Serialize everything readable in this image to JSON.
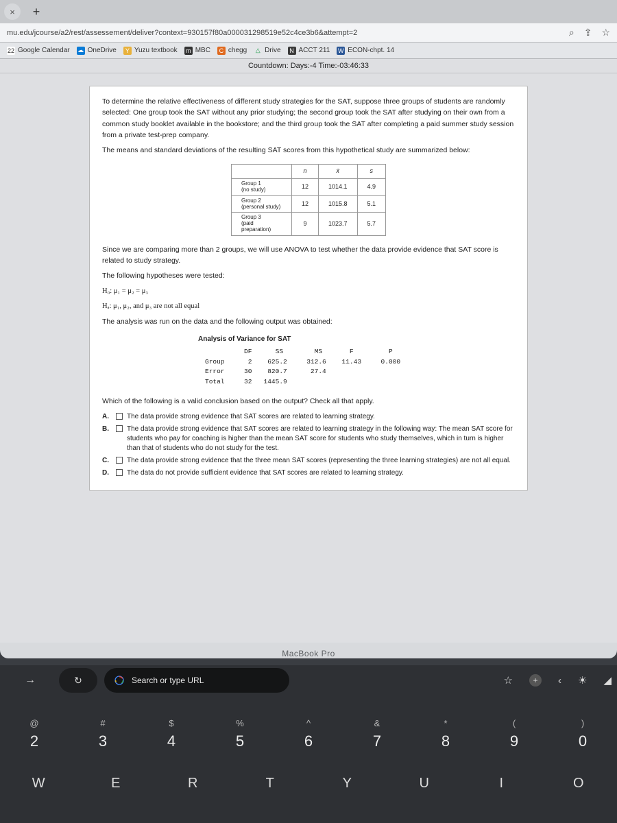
{
  "tabs": {
    "plus": "+",
    "close": "×"
  },
  "url": "mu.edu/jcourse/a2/rest/assessement/deliver?context=930157f80a000031298519e52c4ce3b6&attempt=2",
  "bookmarks": [
    {
      "icon": "22",
      "iconBg": "#fff",
      "iconColor": "#333",
      "label": "Google Calendar"
    },
    {
      "icon": "☁",
      "iconBg": "#0a7bd6",
      "iconColor": "#fff",
      "label": "OneDrive"
    },
    {
      "icon": "Y",
      "iconBg": "#e8b13b",
      "iconColor": "#fff",
      "label": "Yuzu textbook"
    },
    {
      "icon": "m",
      "iconBg": "#333",
      "iconColor": "#fff",
      "label": "MBC"
    },
    {
      "icon": "C",
      "iconBg": "#e06a1f",
      "iconColor": "#fff",
      "label": "chegg"
    },
    {
      "icon": "△",
      "iconBg": "transparent",
      "iconColor": "#1f9d4a",
      "label": "Drive"
    },
    {
      "icon": "N",
      "iconBg": "#3b3b3b",
      "iconColor": "#fff",
      "label": "ACCT 211"
    },
    {
      "icon": "W",
      "iconBg": "#2b5797",
      "iconColor": "#fff",
      "label": "ECON-chpt. 14"
    }
  ],
  "countdown": "Countdown: Days:-4 Time:-03:46:33",
  "question": {
    "p1": "To determine the relative effectiveness of different study strategies for the SAT, suppose three groups of students are randomly selected: One group took the SAT without any prior studying; the second group took the SAT after studying on their own from a common study booklet available in the bookstore; and the third group took the SAT after completing a paid summer study session from a private test-prep company.",
    "p2": "The means and standard deviations of the resulting SAT scores from this hypothetical study are summarized below:",
    "table": {
      "headers": [
        "",
        "n",
        "x̄",
        "s"
      ],
      "rows": [
        {
          "g": "Group 1\n(no study)",
          "n": "12",
          "x": "1014.1",
          "s": "4.9"
        },
        {
          "g": "Group 2\n(personal study)",
          "n": "12",
          "x": "1015.8",
          "s": "5.1"
        },
        {
          "g": "Group 3\n(paid preparation)",
          "n": "9",
          "x": "1023.7",
          "s": "5.7"
        }
      ]
    },
    "p3": "Since we are comparing more than 2 groups, we will use ANOVA to test whether the data provide evidence that SAT score is related to study strategy.",
    "p4": "The following hypotheses were tested:",
    "h0": "H₀: μ₁ = μ₂ = μ₃",
    "ha": "Hₐ: μ₁, μ₂, and μ₃ are not all equal",
    "p5": "The analysis was run on the data and the following output was obtained:",
    "anova_title": "Analysis of Variance for SAT",
    "anova": "          DF      SS        MS       F         P\nGroup      2    625.2     312.6    11.43     0.000\nError     30    820.7      27.4\nTotal     32   1445.9",
    "p6": "Which of the following is a valid conclusion based on the output? Check all that apply.",
    "options": {
      "A": "The data provide strong evidence that SAT scores are related to learning strategy.",
      "B": "The data provide strong evidence that SAT scores are related to learning strategy in the following way: The mean SAT score for students who pay for coaching is higher than the mean SAT score for students who study themselves, which in turn is higher than that of students who do not study for the test.",
      "C": "The data provide strong evidence that the three mean SAT scores (representing the three learning strategies) are not all equal.",
      "D": "The data do not provide sufficient evidence that SAT scores are related to learning strategy."
    }
  },
  "macbook": "MacBook Pro",
  "search_placeholder": "Search or type URL",
  "keys": [
    {
      "sym": "@",
      "num": "2"
    },
    {
      "sym": "#",
      "num": "3"
    },
    {
      "sym": "$",
      "num": "4"
    },
    {
      "sym": "%",
      "num": "5"
    },
    {
      "sym": "^",
      "num": "6"
    },
    {
      "sym": "&",
      "num": "7"
    },
    {
      "sym": "*",
      "num": "8"
    },
    {
      "sym": "(",
      "num": "9"
    },
    {
      "sym": ")",
      "num": "0"
    }
  ],
  "keys2": [
    "W",
    "E",
    "R",
    "T",
    "Y",
    "U",
    "I",
    "O"
  ],
  "star": "☆",
  "share": "⇧",
  "mag": "🔍"
}
